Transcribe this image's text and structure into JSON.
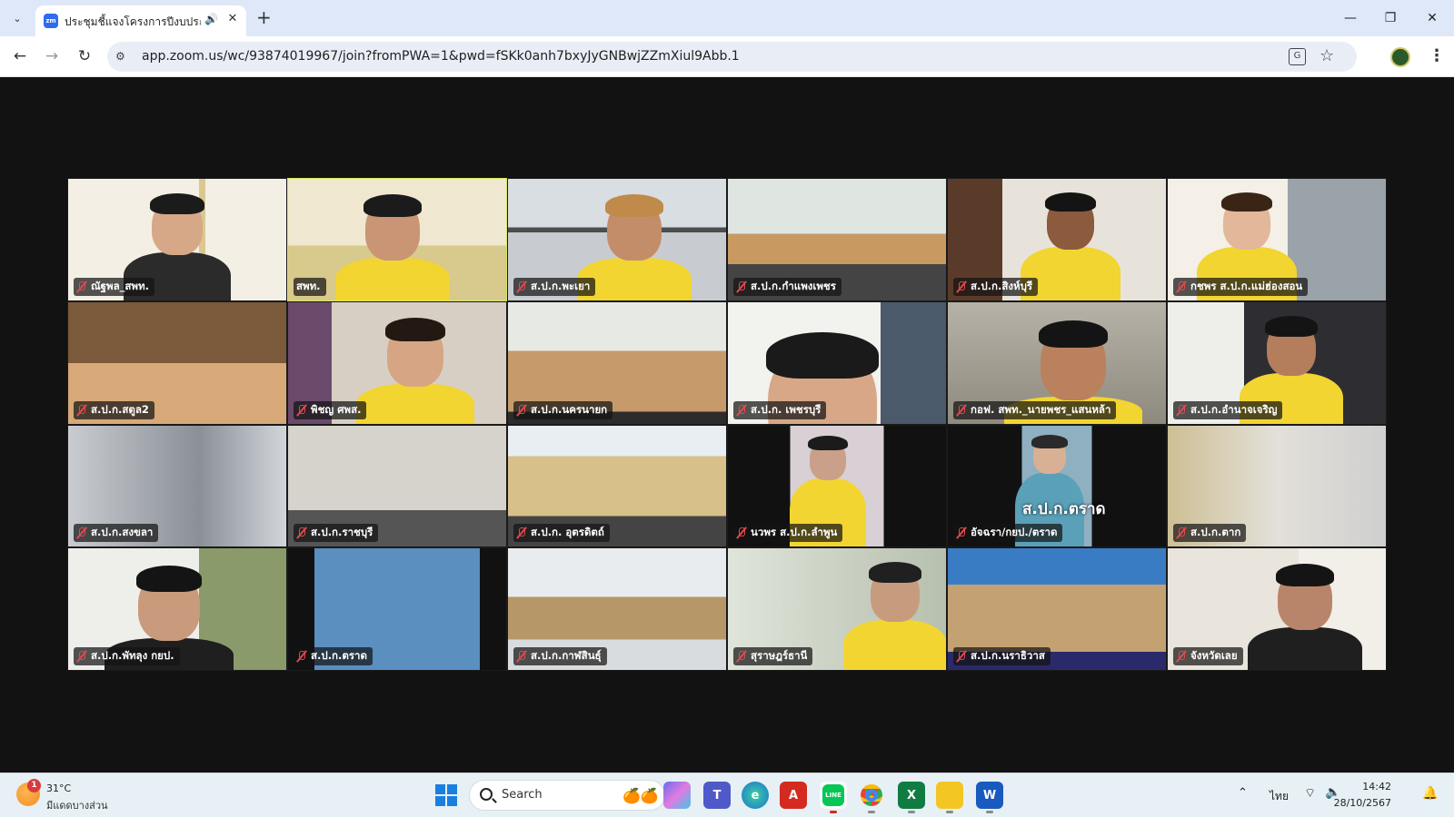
{
  "browser": {
    "tab_title": "ประชุมชี้แจงโครงการปีงบประมาณ",
    "new_tab_label": "+",
    "url": "app.zoom.us/wc/93874019967/join?fromPWA=1&pwd=fSKk0anh7bxyJyGNBwjZZmXiul9Abb.1",
    "favicon_text": "zm"
  },
  "meeting": {
    "participants": [
      {
        "name": "ณัฐพล_สพท.",
        "muted": true
      },
      {
        "name": "สพท.",
        "muted": false,
        "speaking": true
      },
      {
        "name": "ส.ป.ก.พะเยา",
        "muted": true
      },
      {
        "name": "ส.ป.ก.กำแพงเพชร",
        "muted": true
      },
      {
        "name": "ส.ป.ก.สิงห์บุรี",
        "muted": true
      },
      {
        "name": "กชพร ส.ป.ก.แม่ฮ่องสอน",
        "muted": true
      },
      {
        "name": "ส.ป.ก.สตูล2",
        "muted": true
      },
      {
        "name": "พิชญ ศพส.",
        "muted": true
      },
      {
        "name": "ส.ป.ก.นครนายก",
        "muted": true
      },
      {
        "name": "ส.ป.ก. เพชรบุรี",
        "muted": true
      },
      {
        "name": "กอฟ. สพท._นายพชร_แสนหล้า",
        "muted": true
      },
      {
        "name": "ส.ป.ก.อำนาจเจริญ",
        "muted": true
      },
      {
        "name": "ส.ป.ก.สงขลา",
        "muted": true
      },
      {
        "name": "ส.ป.ก.ราชบุรี",
        "muted": true
      },
      {
        "name": "ส.ป.ก. อุตรดิตถ์",
        "muted": true
      },
      {
        "name": "นวพร ส.ป.ก.ลำพูน",
        "muted": true
      },
      {
        "name": "อัจฉรา/กยป./ตราด",
        "muted": true,
        "overlay": "ส.ป.ก.ตราด"
      },
      {
        "name": "ส.ป.ก.ตาก",
        "muted": true
      },
      {
        "name": "ส.ป.ก.พัทลุง กยป.",
        "muted": true
      },
      {
        "name": "ส.ป.ก.ตราด",
        "muted": true
      },
      {
        "name": "ส.ป.ก.กาฬสินธุ์",
        "muted": true
      },
      {
        "name": "สุราษฎร์ธานี",
        "muted": true
      },
      {
        "name": "ส.ป.ก.นราธิวาส",
        "muted": true
      },
      {
        "name": "จังหวัดเลย",
        "muted": true
      }
    ]
  },
  "taskbar": {
    "weather_badge": "1",
    "weather_temp": "31°C",
    "weather_desc": "มีแดดบางส่วน",
    "search_label": "Search",
    "tray_lang": "ไทย",
    "clock_time": "14:42",
    "clock_date": "28/10/2567"
  },
  "colors": {
    "mute_icon": "#e5484d",
    "speaking_outline": "#d8e85a",
    "shirt_yellow": "#f2d530"
  }
}
